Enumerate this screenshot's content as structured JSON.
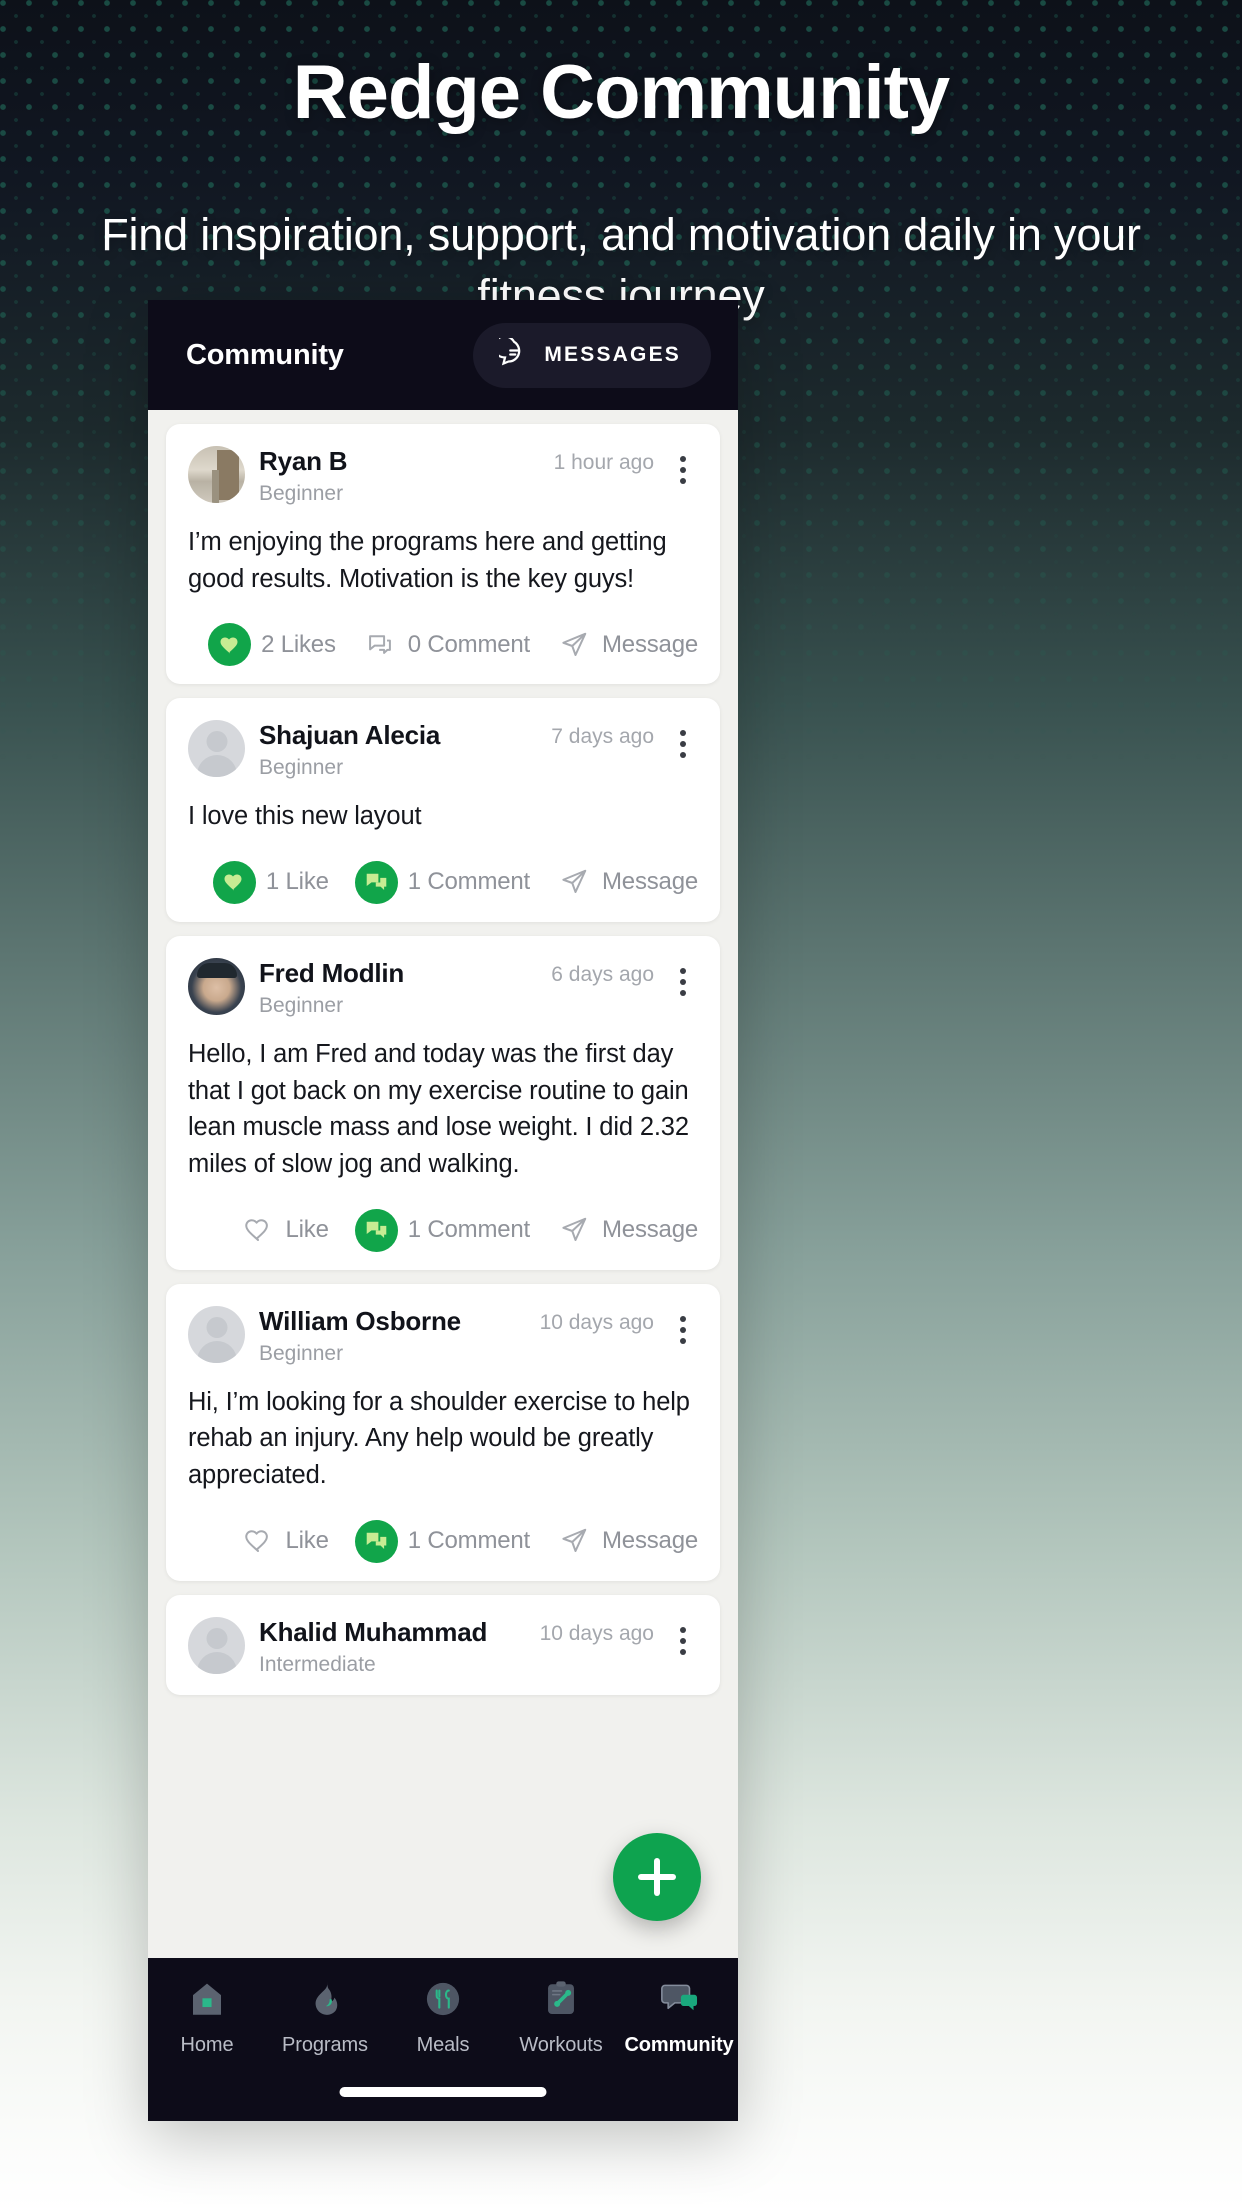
{
  "promo": {
    "title": "Redge Community",
    "subtitle": "Find inspiration, support, and motivation daily in your fitness journey"
  },
  "app": {
    "header": {
      "title": "Community",
      "messages_label": "MESSAGES",
      "messages_icon": "chat-bubble-lines-icon"
    },
    "fab": {
      "icon": "plus-icon",
      "label": "+"
    },
    "posts": [
      {
        "name": "Ryan B",
        "level": "Beginner",
        "time": "1 hour ago",
        "body": "I’m enjoying the programs here and getting good results. Motivation is the key guys!",
        "avatar": "photo-ryan",
        "like": {
          "label": "2 Likes",
          "active": true,
          "icon": "heart-icon"
        },
        "comment": {
          "label": "0 Comment",
          "active": false,
          "icon": "comment-icon"
        },
        "message": {
          "label": "Message",
          "active": false,
          "icon": "send-icon"
        }
      },
      {
        "name": "Shajuan  Alecia",
        "level": "Beginner",
        "time": "7 days ago",
        "body": "I love this new layout",
        "avatar": "placeholder",
        "like": {
          "label": "1 Like",
          "active": true,
          "icon": "heart-icon"
        },
        "comment": {
          "label": "1 Comment",
          "active": true,
          "icon": "comment-icon"
        },
        "message": {
          "label": "Message",
          "active": false,
          "icon": "send-icon"
        }
      },
      {
        "name": "Fred Modlin",
        "level": "Beginner",
        "time": "6 days ago",
        "body": "Hello, I am Fred and today was the first day that I got back on my exercise routine to gain lean muscle mass and lose weight. I did 2.32 miles of slow jog and walking.",
        "avatar": "photo-fred",
        "like": {
          "label": "Like",
          "active": false,
          "icon": "heart-icon"
        },
        "comment": {
          "label": "1 Comment",
          "active": true,
          "icon": "comment-icon"
        },
        "message": {
          "label": "Message",
          "active": false,
          "icon": "send-icon"
        }
      },
      {
        "name": "William Osborne",
        "level": "Beginner",
        "time": "10 days ago",
        "body": "Hi, I’m looking for a shoulder exercise to help rehab an injury. Any help would be greatly appreciated.",
        "avatar": "placeholder",
        "like": {
          "label": "Like",
          "active": false,
          "icon": "heart-icon"
        },
        "comment": {
          "label": "1 Comment",
          "active": true,
          "icon": "comment-icon"
        },
        "message": {
          "label": "Message",
          "active": false,
          "icon": "send-icon"
        }
      },
      {
        "name": "Khalid Muhammad",
        "level": "Intermediate",
        "time": "10 days ago",
        "body": "",
        "avatar": "placeholder",
        "like": null,
        "comment": null,
        "message": null
      }
    ],
    "bottom_nav": [
      {
        "label": "Home",
        "icon": "house-icon",
        "active": false
      },
      {
        "label": "Programs",
        "icon": "flame-icon",
        "active": false
      },
      {
        "label": "Meals",
        "icon": "fork-knife-icon",
        "active": false
      },
      {
        "label": "Workouts",
        "icon": "clipboard-dumbbell-icon",
        "active": false
      },
      {
        "label": "Community",
        "icon": "chat-bubbles-icon",
        "active": true
      }
    ]
  },
  "colors": {
    "accent_green": "#11a54a",
    "fab_green": "#0ea34f",
    "icon_light_green": "#c7ec93",
    "nav_dark": "#0d0c19",
    "nav_icon_gray": "#5b6370",
    "nav_icon_green": "#2bb88a",
    "muted_text": "#8f9299",
    "dot_teal": "#226e5c"
  }
}
